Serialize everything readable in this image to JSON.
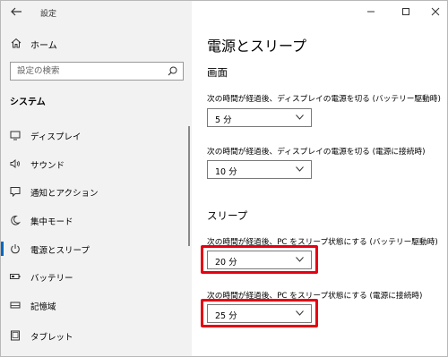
{
  "window": {
    "app_title": "設定"
  },
  "sidebar": {
    "home_label": "ホーム",
    "search_placeholder": "設定の検索",
    "section_heading": "システム",
    "items": [
      {
        "label": "ディスプレイ",
        "icon": "monitor-icon"
      },
      {
        "label": "サウンド",
        "icon": "speaker-icon"
      },
      {
        "label": "通知とアクション",
        "icon": "notification-icon"
      },
      {
        "label": "集中モード",
        "icon": "moon-icon"
      },
      {
        "label": "電源とスリープ",
        "icon": "power-icon",
        "selected": true
      },
      {
        "label": "バッテリー",
        "icon": "battery-icon"
      },
      {
        "label": "記憶域",
        "icon": "storage-icon"
      },
      {
        "label": "タブレット",
        "icon": "tablet-icon"
      }
    ]
  },
  "main": {
    "page_title": "電源とスリープ",
    "screen": {
      "title": "画面",
      "settings": [
        {
          "label": "次の時間が経過後、ディスプレイの電源を切る (バッテリー駆動時)",
          "value": "5 分"
        },
        {
          "label": "次の時間が経過後、ディスプレイの電源を切る (電源に接続時)",
          "value": "10 分"
        }
      ]
    },
    "sleep": {
      "title": "スリープ",
      "settings": [
        {
          "label": "次の時間が経過後、PC をスリープ状態にする (バッテリー駆動時)",
          "value": "20 分",
          "highlighted": true
        },
        {
          "label": "次の時間が経過後、PC をスリープ状態にする (電源に接続時)",
          "value": "25 分",
          "highlighted": true
        }
      ]
    }
  },
  "colors": {
    "accent": "#0067c0",
    "highlight": "#e60012",
    "sidebar_bg": "#f2f2f2"
  }
}
